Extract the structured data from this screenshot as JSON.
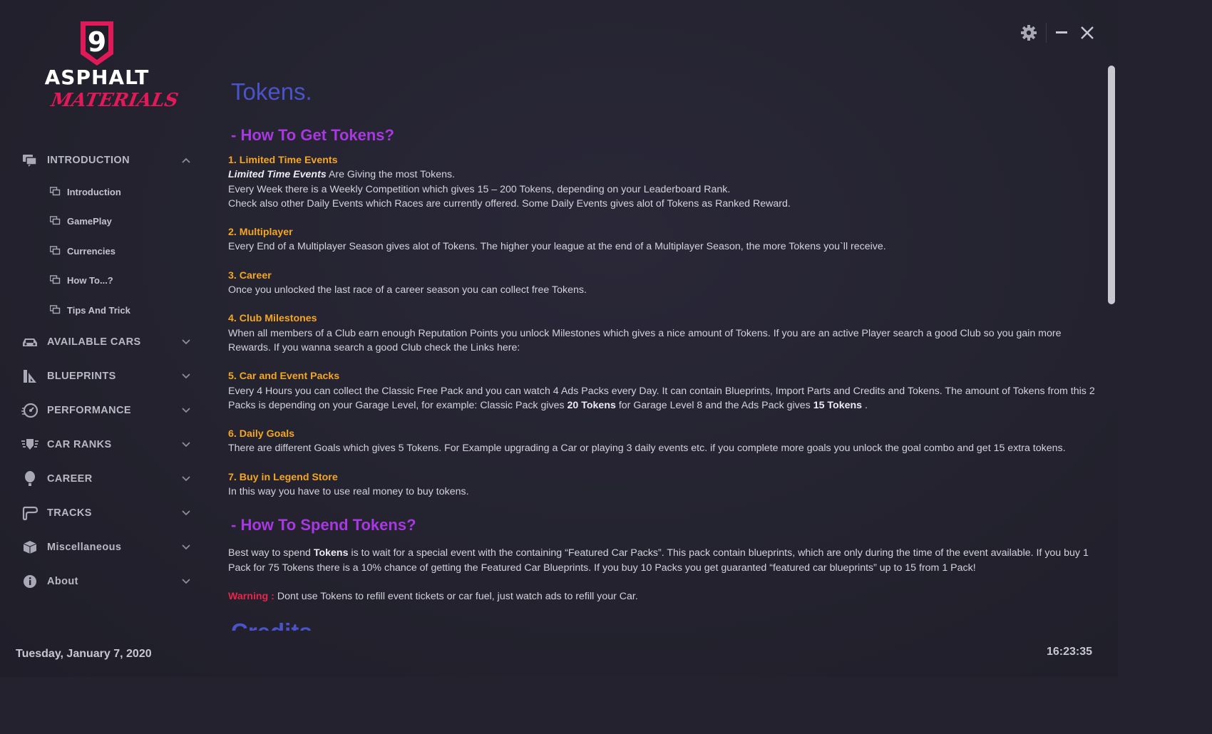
{
  "app": {
    "logo_badge": "9",
    "logo_word": "ASPHALT",
    "logo_sub": "MATERIALS"
  },
  "colors": {
    "accent_blue": "#4a53c9",
    "accent_purple": "#a838e0",
    "item_title": "#f5a623",
    "warning": "#e8264c",
    "brand_red": "#e01a58"
  },
  "sidebar": {
    "sections": [
      {
        "label": "INTRODUCTION",
        "icon": "chat-icon",
        "expanded": true
      },
      {
        "label": "AVAILABLE CARS",
        "icon": "car-icon",
        "expanded": false
      },
      {
        "label": "BLUEPRINTS",
        "icon": "blueprint-icon",
        "expanded": false
      },
      {
        "label": "PERFORMANCE",
        "icon": "speedometer-icon",
        "expanded": false
      },
      {
        "label": "CAR RANKS",
        "icon": "rank-badge-icon",
        "expanded": false
      },
      {
        "label": "CAREER",
        "icon": "balloon-icon",
        "expanded": false
      },
      {
        "label": "TRACKS",
        "icon": "track-icon",
        "expanded": false
      },
      {
        "label": "Miscellaneous",
        "icon": "box-icon",
        "expanded": false
      },
      {
        "label": "About",
        "icon": "info-icon",
        "expanded": false
      }
    ],
    "sub_items": [
      {
        "label": "Introduction",
        "icon": "chat-icon"
      },
      {
        "label": "GamePlay",
        "icon": "chat-icon"
      },
      {
        "label": "Currencies",
        "icon": "chat-icon"
      },
      {
        "label": "How To...?",
        "icon": "chat-icon"
      },
      {
        "label": "Tips And Trick",
        "icon": "chat-icon"
      }
    ]
  },
  "window_controls": {
    "settings": "gear-icon",
    "minimize": "minimize-icon",
    "close": "close-icon"
  },
  "content": {
    "title": "Tokens.",
    "get_section_title": "- How To Get Tokens?",
    "items": [
      {
        "title": "1. Limited Time Events",
        "lead_bold": "Limited Time Events",
        "lead_rest": " Are Giving the most Tokens.",
        "lines": [
          "Every Week there is a Weekly Competition which gives 15 – 200 Tokens, depending on your Leaderboard Rank.",
          "Check also other Daily Events which Races are currently offered. Some Daily Events gives alot of Tokens as Ranked Reward."
        ]
      },
      {
        "title": "2. Multiplayer",
        "text": "Every End of a Multiplayer Season gives alot of Tokens. The higher your league at the end of a Multiplayer Season, the more Tokens you`ll receive."
      },
      {
        "title": "3. Career",
        "text": "Once you unlocked the last race of a career season you can collect free Tokens."
      },
      {
        "title": "4. Club Milestones",
        "text": "When all members of a Club earn enough Reputation Points you unlock Milestones which gives a nice amount of Tokens. If you are an active Player search a good Club so you gain more Rewards. If you wanna search a good Club check the Links here:"
      },
      {
        "title": "5. Car and Event Packs",
        "text_a": "Every 4 Hours you can collect the Classic Free Pack and you can watch 4 Ads Packs every Day. It can contain Blueprints, Import Parts and Credits and Tokens. The amount of Tokens from this 2 Packs is depending on your Garage Level, for example: Classic Pack gives ",
        "bold_a": "20 Tokens",
        "text_b": " for Garage Level 8 and the Ads Pack gives ",
        "bold_b": "15 Tokens",
        "text_c": " ."
      },
      {
        "title": "6. Daily Goals",
        "text": "There are different Goals which gives 5 Tokens. For Example upgrading a Car or playing 3 daily events etc. if you complete more goals you unlock the goal combo and get 15 extra tokens."
      },
      {
        "title": "7. Buy in Legend Store",
        "text": "In this way you have to use real money to buy tokens."
      }
    ],
    "spend_section_title": "- How To Spend Tokens?",
    "spend": {
      "text_a": "Best way to spend ",
      "bold": "Tokens",
      "text_b": " is to wait for a special event with the containing “Featured Car Packs”. This pack contain blueprints, which are only during the time of the event available. If you buy 1 Pack for 75 Tokens there is a 10% chance of getting the Featured Car Blueprints. If you buy 10 Packs you get guaranted “featured car blueprints” up to 15 from 1 Pack!"
    },
    "warning_label": "Warning :",
    "warning_text": " Dont use Tokens to refill event tickets or car fuel, just watch ads to refill your Car.",
    "next_title": "Credits"
  },
  "footer": {
    "date": "Tuesday, January 7, 2020",
    "time": "16:23:35"
  }
}
